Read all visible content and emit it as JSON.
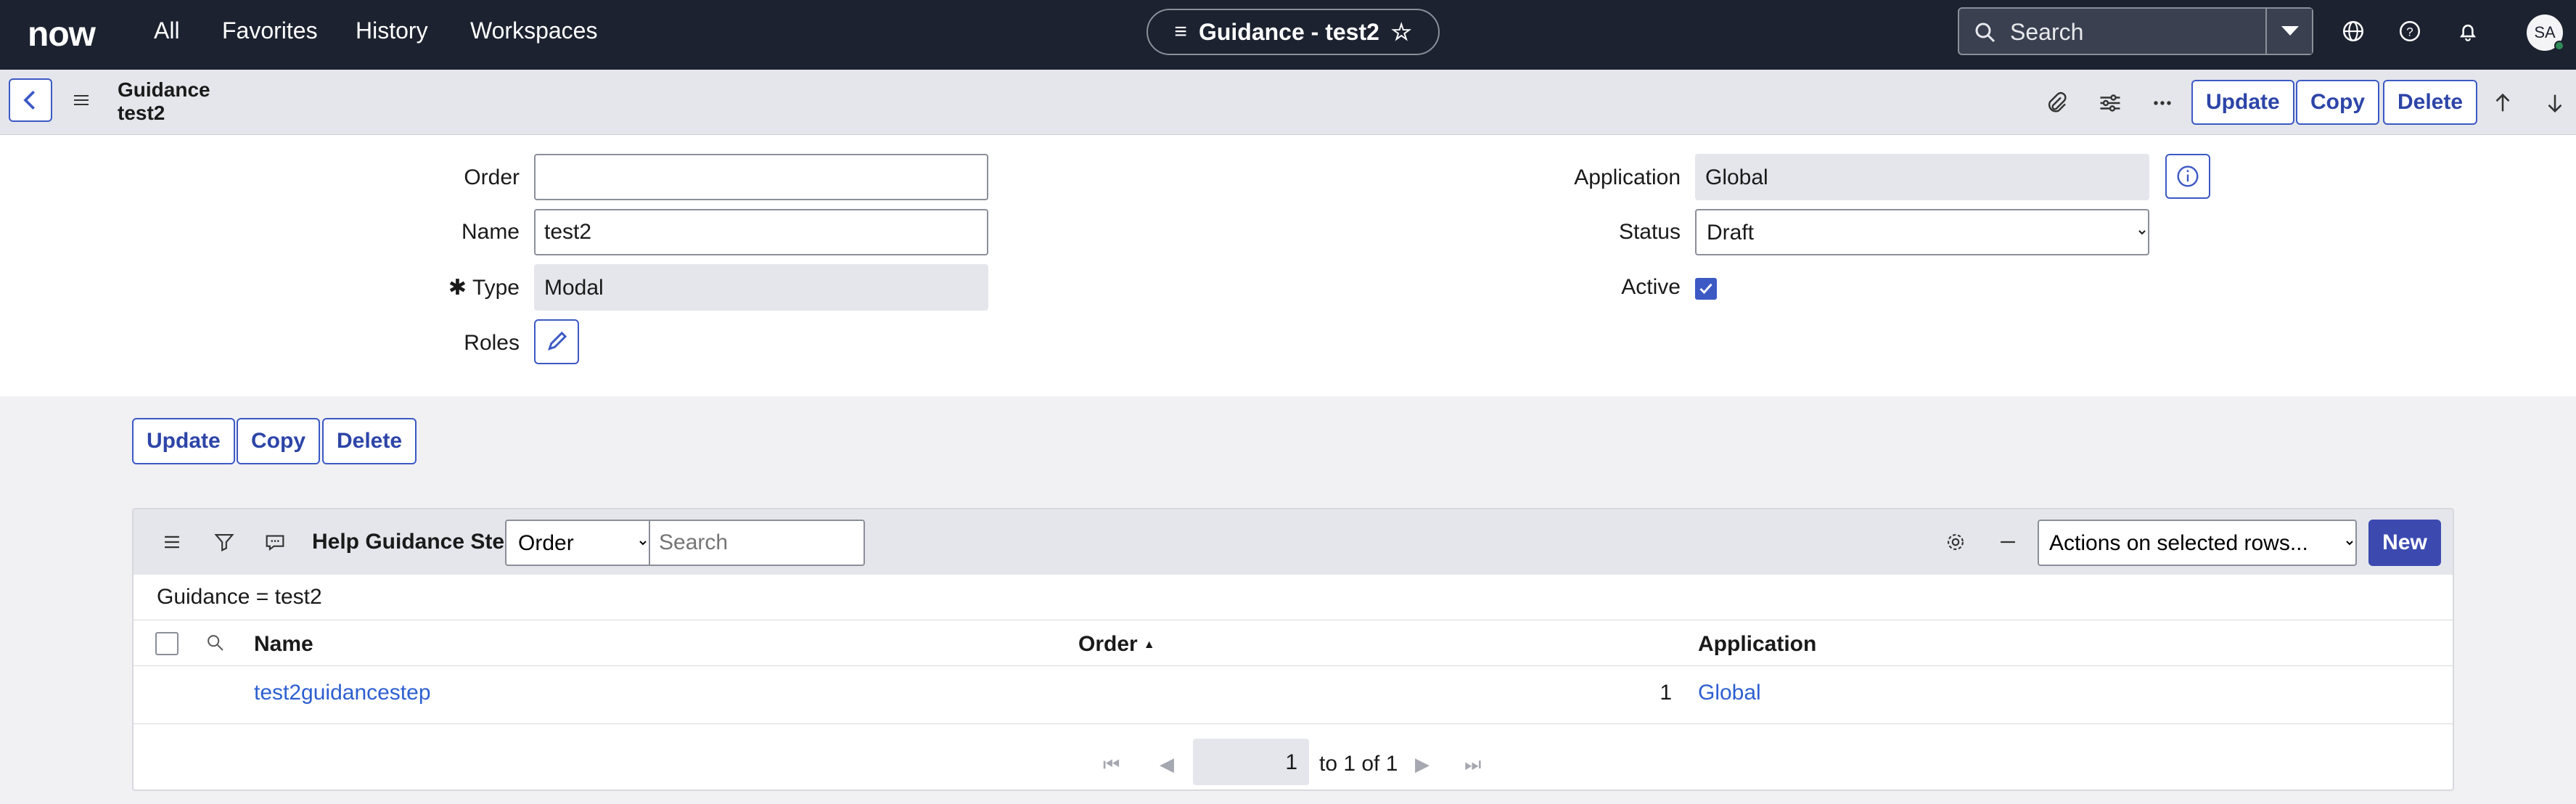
{
  "topnav": {
    "logo": "now",
    "links": [
      "All",
      "Favorites",
      "History",
      "Workspaces"
    ],
    "context_title": "Guidance - test2",
    "search_placeholder": "Search",
    "avatar": "SA"
  },
  "header": {
    "record_type": "Guidance",
    "record_name": "test2",
    "buttons": {
      "update": "Update",
      "copy": "Copy",
      "delete": "Delete"
    }
  },
  "form": {
    "order": {
      "label": "Order",
      "value": ""
    },
    "name": {
      "label": "Name",
      "value": "test2"
    },
    "type": {
      "label": "Type",
      "value": "Modal",
      "required_mark": "✱"
    },
    "roles": {
      "label": "Roles"
    },
    "application": {
      "label": "Application",
      "value": "Global"
    },
    "status": {
      "label": "Status",
      "value": "Draft"
    },
    "active": {
      "label": "Active",
      "checked": true
    }
  },
  "form_buttons": {
    "update": "Update",
    "copy": "Copy",
    "delete": "Delete"
  },
  "related_list": {
    "title": "Help Guidance Steps",
    "search_field": "Order",
    "search_placeholder": "Search",
    "actions": "Actions on selected rows...",
    "new_label": "New",
    "filter_text": "Guidance = test2",
    "columns": {
      "name": "Name",
      "order": "Order",
      "application": "Application"
    },
    "rows": [
      {
        "name": "test2guidancestep",
        "order": "1",
        "application": "Global"
      }
    ],
    "pager": {
      "page": "1",
      "range_text": "to 1 of 1"
    }
  },
  "colors": {
    "nav_bg": "#1d2230",
    "accent": "#3c59c4",
    "link": "#2d5fd0"
  }
}
